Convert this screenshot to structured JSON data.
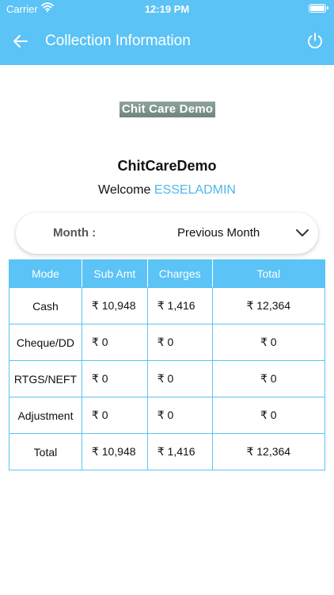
{
  "status_bar": {
    "carrier": "Carrier",
    "time": "12:19 PM"
  },
  "nav": {
    "title": "Collection Information",
    "back_icon": "arrow-left-icon",
    "power_icon": "power-icon"
  },
  "logo_text": "Chit Care Demo",
  "company_name": "ChitCareDemo",
  "welcome": {
    "prefix": "Welcome",
    "username": "ESSELADMIN"
  },
  "month_selector": {
    "label": "Month :",
    "value": "Previous Month"
  },
  "table": {
    "headers": [
      "Mode",
      "Sub Amt",
      "Charges",
      "Total"
    ],
    "rows": [
      {
        "mode": "Cash",
        "sub_amt": "₹ 10,948",
        "charges": "₹ 1,416",
        "total": "₹ 12,364"
      },
      {
        "mode": "Cheque/DD",
        "sub_amt": "₹ 0",
        "charges": "₹ 0",
        "total": "₹ 0"
      },
      {
        "mode": "RTGS/NEFT",
        "sub_amt": "₹ 0",
        "charges": "₹ 0",
        "total": "₹ 0"
      },
      {
        "mode": "Adjustment",
        "sub_amt": "₹ 0",
        "charges": "₹ 0",
        "total": "₹ 0"
      },
      {
        "mode": "Total",
        "sub_amt": "₹ 10,948",
        "charges": "₹ 1,416",
        "total": "₹ 12,364"
      }
    ]
  },
  "colors": {
    "accent": "#5bc3f5",
    "username": "#4fb7ea"
  }
}
